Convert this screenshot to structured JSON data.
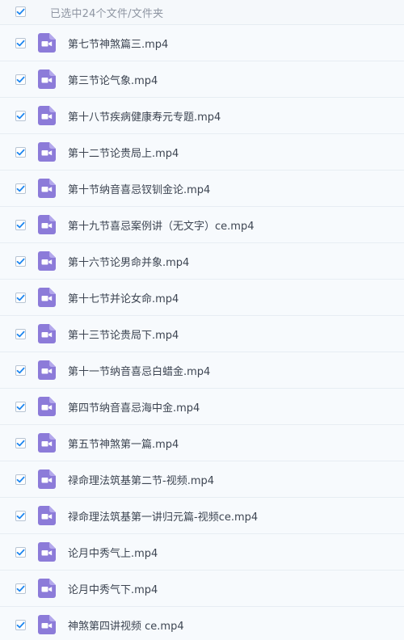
{
  "header": {
    "select_all_checked": true,
    "selection_text": "已选中24个文件/文件夹"
  },
  "files": [
    {
      "name": "第七节神煞篇三.mp4",
      "checked": true,
      "icon": "video-file-icon"
    },
    {
      "name": "第三节论气象.mp4",
      "checked": true,
      "icon": "video-file-icon"
    },
    {
      "name": "第十八节疾病健康寿元专题.mp4",
      "checked": true,
      "icon": "video-file-icon"
    },
    {
      "name": "第十二节论贵局上.mp4",
      "checked": true,
      "icon": "video-file-icon"
    },
    {
      "name": "第十节纳音喜忌钗钏金论.mp4",
      "checked": true,
      "icon": "video-file-icon"
    },
    {
      "name": "第十九节喜忌案例讲（无文字）ce.mp4",
      "checked": true,
      "icon": "video-file-icon"
    },
    {
      "name": "第十六节论男命并象.mp4",
      "checked": true,
      "icon": "video-file-icon"
    },
    {
      "name": "第十七节并论女命.mp4",
      "checked": true,
      "icon": "video-file-icon"
    },
    {
      "name": "第十三节论贵局下.mp4",
      "checked": true,
      "icon": "video-file-icon"
    },
    {
      "name": "第十一节纳音喜忌白蜡金.mp4",
      "checked": true,
      "icon": "video-file-icon"
    },
    {
      "name": "第四节纳音喜忌海中金.mp4",
      "checked": true,
      "icon": "video-file-icon"
    },
    {
      "name": "第五节神煞第一篇.mp4",
      "checked": true,
      "icon": "video-file-icon"
    },
    {
      "name": "禄命理法筑基第二节-视频.mp4",
      "checked": true,
      "icon": "video-file-icon"
    },
    {
      "name": "禄命理法筑基第一讲归元篇-视频ce.mp4",
      "checked": true,
      "icon": "video-file-icon"
    },
    {
      "name": "论月中秀气上.mp4",
      "checked": true,
      "icon": "video-file-icon"
    },
    {
      "name": "论月中秀气下.mp4",
      "checked": true,
      "icon": "video-file-icon"
    },
    {
      "name": "神煞第四讲视频 ce.mp4",
      "checked": true,
      "icon": "video-file-icon"
    }
  ],
  "colors": {
    "checkbox_check": "#1e87f0",
    "checkbox_border": "#b7c4d3",
    "video_icon_bg": "#8c7bd9",
    "row_bg": "#f7fafd",
    "row_divider": "#e7edf3",
    "text": "#3d4552",
    "header_text": "#8f96a3"
  }
}
